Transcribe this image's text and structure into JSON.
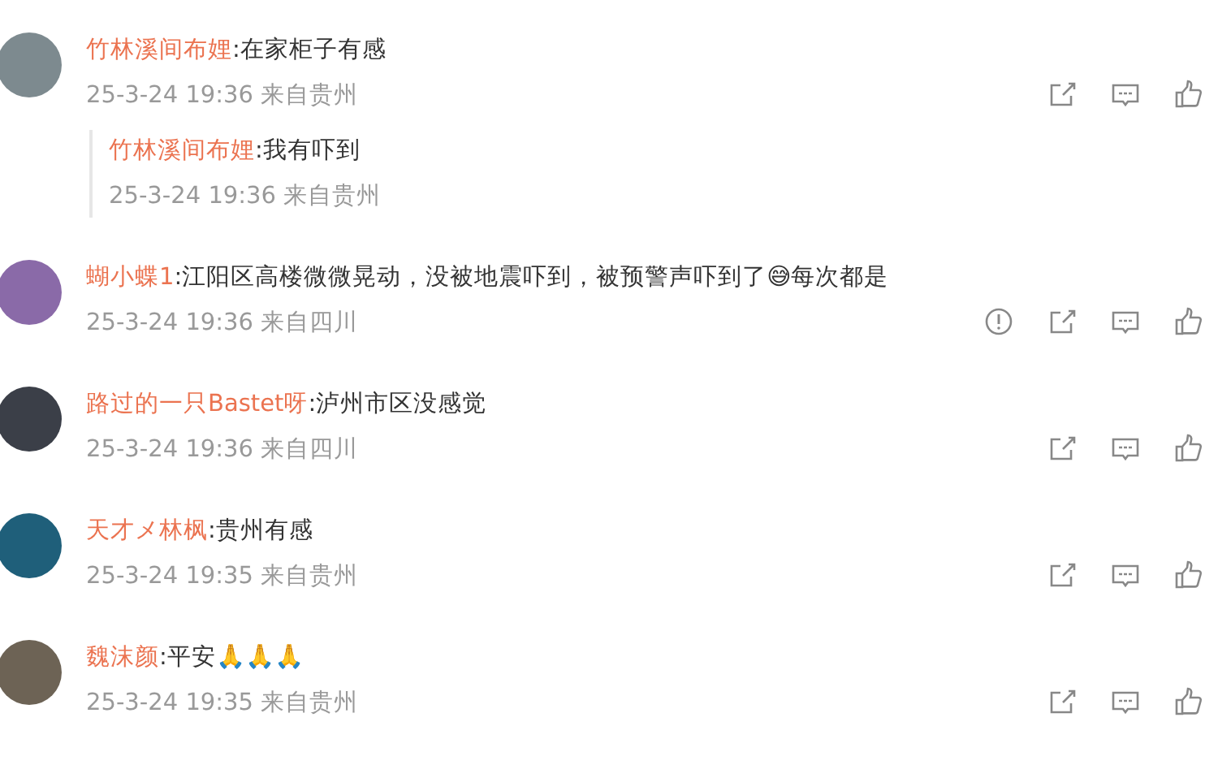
{
  "comments": [
    {
      "name": "竹林溪间布娌",
      "text": ":在家柜子有感",
      "meta": "25-3-24 19:36 来自贵州",
      "actions": [
        {
          "kind": "share"
        },
        {
          "kind": "comment"
        },
        {
          "kind": "like"
        }
      ],
      "replies": [
        {
          "name": "竹林溪间布娌",
          "text": ":我有吓到",
          "meta": "25-3-24 19:36 来自贵州"
        }
      ]
    },
    {
      "name": "蝴小蝶1",
      "text": ":江阳区高楼微微晃动，没被地震吓到，被预警声吓到了😅每次都是",
      "meta": "25-3-24 19:36 来自四川",
      "actions": [
        {
          "kind": "report"
        },
        {
          "kind": "share"
        },
        {
          "kind": "comment"
        },
        {
          "kind": "like"
        }
      ]
    },
    {
      "name": "路过的一只Bastet呀",
      "text": ":泸州市区没感觉",
      "meta": "25-3-24 19:36 来自四川",
      "actions": [
        {
          "kind": "share"
        },
        {
          "kind": "comment"
        },
        {
          "kind": "like"
        }
      ]
    },
    {
      "name": "天才メ林枫",
      "text": ":贵州有感",
      "meta": "25-3-24 19:35 来自贵州",
      "actions": [
        {
          "kind": "share"
        },
        {
          "kind": "comment"
        },
        {
          "kind": "like"
        }
      ]
    },
    {
      "name": "魏沫颜",
      "text": ":平安🙏🙏🙏",
      "meta": "25-3-24 19:35 来自贵州",
      "actions": [
        {
          "kind": "share"
        },
        {
          "kind": "comment"
        },
        {
          "kind": "like"
        }
      ]
    }
  ]
}
